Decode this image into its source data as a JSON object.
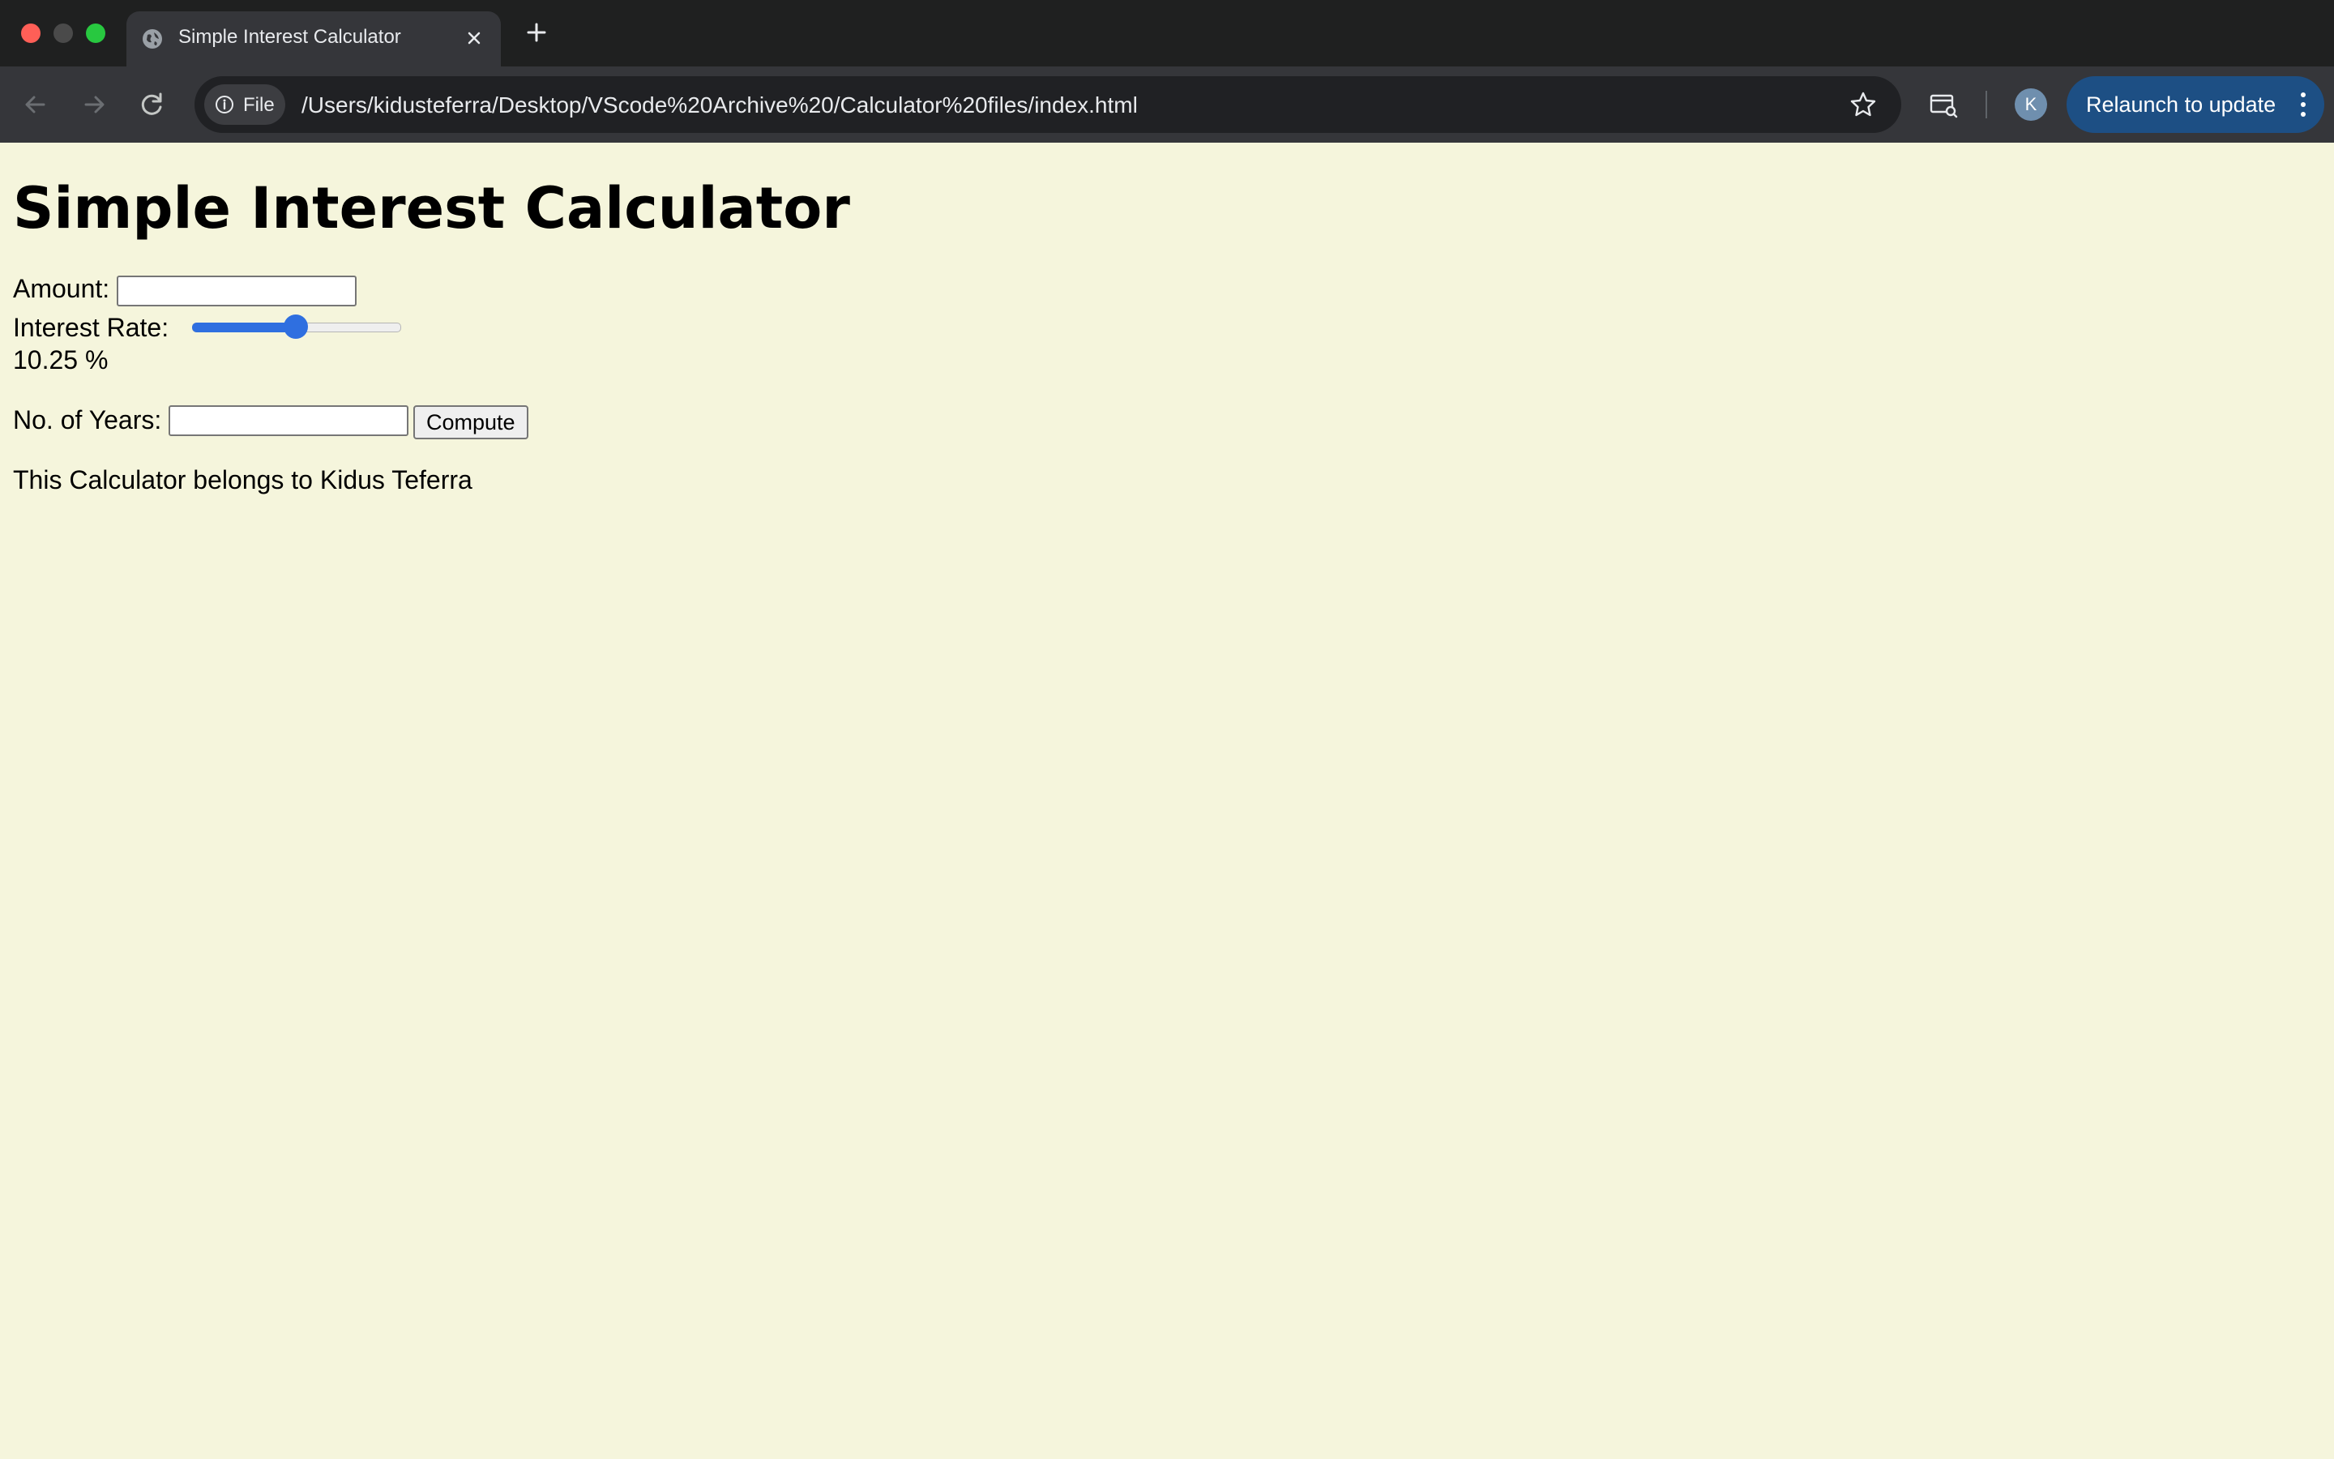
{
  "browser": {
    "tab_title": "Simple Interest Calculator",
    "site_chip_label": "File",
    "url": "/Users/kidusteferra/Desktop/VScode%20Archive%20/Calculator%20files/index.html",
    "avatar_initial": "K",
    "relaunch_label": "Relaunch to update"
  },
  "page": {
    "title": "Simple Interest Calculator",
    "amount_label": "Amount:",
    "amount_value": "",
    "rate_label": "Interest Rate:",
    "rate_slider_fraction": 0.5,
    "rate_display": "10.25 %",
    "years_label": "No. of Years:",
    "years_value": "",
    "compute_label": "Compute",
    "owner_text": "This Calculator belongs to Kidus Teferra"
  },
  "colors": {
    "page_background": "#f5f5dc",
    "slider_accent": "#2f6fe0",
    "relaunch_background": "#1d4f84"
  }
}
